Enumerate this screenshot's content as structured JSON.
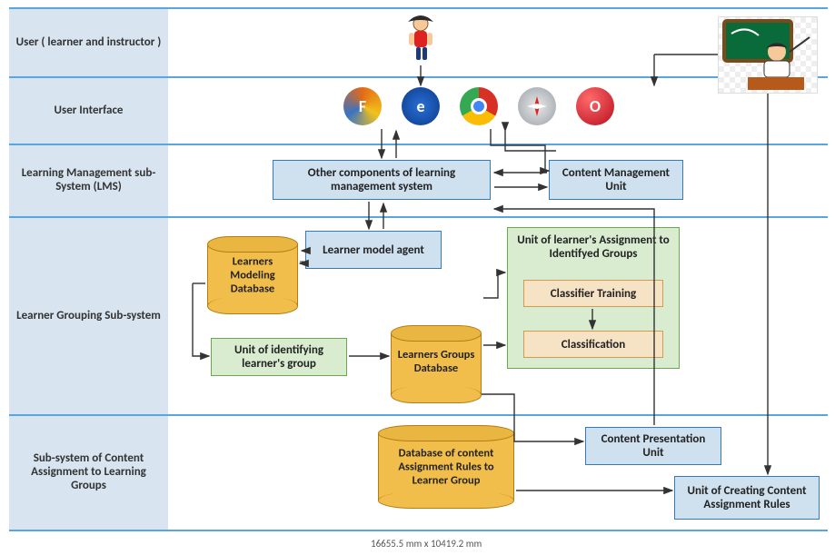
{
  "rows": {
    "r1": "User ( learner and instructor )",
    "r2": "User Interface",
    "r3": "Learning Management sub-System (LMS)",
    "r4": "Learner Grouping Sub-system",
    "r5": "Sub-system of Content Assignment to Learning Groups"
  },
  "boxes": {
    "lms_other": "Other components of learning management system",
    "cmu": "Content Management Unit",
    "lma": "Learner model agent",
    "ula_title": "Unit of learner's Assignment to Identifyed Groups",
    "clf_train": "Classifier Training",
    "clf": "Classification",
    "uig": "Unit of identifying learner's group",
    "cpu": "Content Presentation Unit",
    "uccar": "Unit of Creating Content Assignment Rules"
  },
  "dbs": {
    "lmd": "Learners Modeling Database",
    "lgd": "Learners Groups Database",
    "dcar": "Database of content Assignment Rules to Learner Group"
  },
  "footer": "16655.5 mm x 10419.2 mm",
  "icons": {
    "firefox": "F",
    "ie": "e",
    "chrome": "C",
    "safari": "S",
    "opera": "O"
  }
}
